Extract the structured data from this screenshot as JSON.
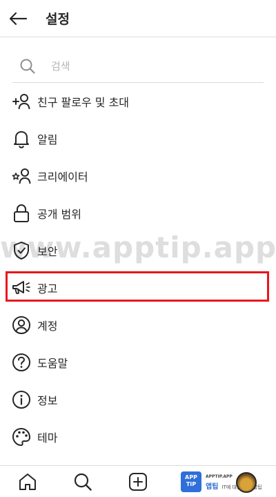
{
  "header": {
    "title": "설정"
  },
  "search": {
    "placeholder": "검색"
  },
  "menu": {
    "items": [
      {
        "label": "친구 팔로우 및 초대",
        "icon": "add-person-icon"
      },
      {
        "label": "알림",
        "icon": "bell-icon"
      },
      {
        "label": "크리에이터",
        "icon": "creator-icon"
      },
      {
        "label": "공개 범위",
        "icon": "lock-icon"
      },
      {
        "label": "보안",
        "icon": "shield-check-icon"
      },
      {
        "label": "광고",
        "icon": "megaphone-icon"
      },
      {
        "label": "계정",
        "icon": "account-circle-icon"
      },
      {
        "label": "도움말",
        "icon": "help-circle-icon"
      },
      {
        "label": "정보",
        "icon": "info-circle-icon"
      },
      {
        "label": "테마",
        "icon": "palette-icon"
      }
    ]
  },
  "watermark": {
    "text": "www.apptip.app"
  },
  "badge": {
    "logo_line1": "APP",
    "logo_line2": "TIP",
    "url": "APPTIP.APP",
    "title": "앱팁",
    "subtitle": "IT에 대한 모든 꿀팁"
  },
  "colors": {
    "highlight": "#e8151d",
    "text": "#262626",
    "divider": "#dbdbdb",
    "badge_blue": "#2e6fd9"
  }
}
